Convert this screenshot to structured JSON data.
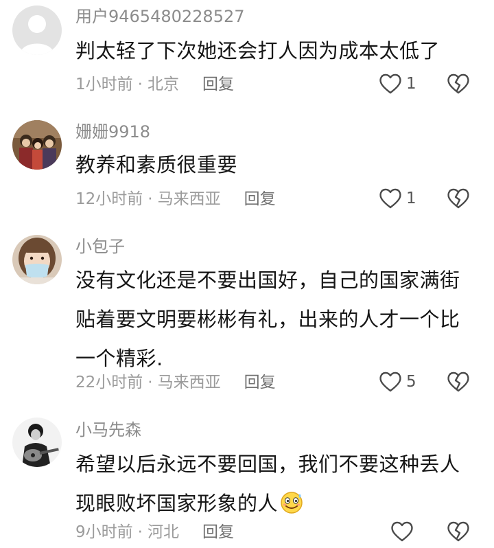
{
  "comments": [
    {
      "username": "用户9465480228527",
      "avatar_icon": "default-user-avatar",
      "content": "判太轻了下次她还会打人因为成本太低了",
      "time": "1小时前",
      "location": "北京",
      "reply_label": "回复",
      "likes": "1"
    },
    {
      "username": "姗姗9918",
      "avatar_icon": "family-photo-avatar",
      "content": "教养和素质很重要",
      "time": "12小时前",
      "location": "马来西亚",
      "reply_label": "回复",
      "likes": "1"
    },
    {
      "username": "小包子",
      "avatar_icon": "masked-girl-avatar",
      "content": "没有文化还是不要出国好，自己的国家满街贴着要文明要彬彬有礼，出来的人才一个比一个精彩.",
      "time": "22小时前",
      "location": "马来西亚",
      "reply_label": "回复",
      "likes": "5"
    },
    {
      "username": "小马先森",
      "avatar_icon": "guitar-player-avatar",
      "content": "希望以后永远不要回国，我们不要这种丢人现眼败坏国家形象的人",
      "emoji": "awkward-smile-emoji",
      "time": "9小时前",
      "location": "河北",
      "reply_label": "回复",
      "likes": ""
    }
  ],
  "separator": "·",
  "colors": {
    "text": "#161616",
    "muted": "#8c8c8c",
    "icon": "#4a4a4a"
  }
}
